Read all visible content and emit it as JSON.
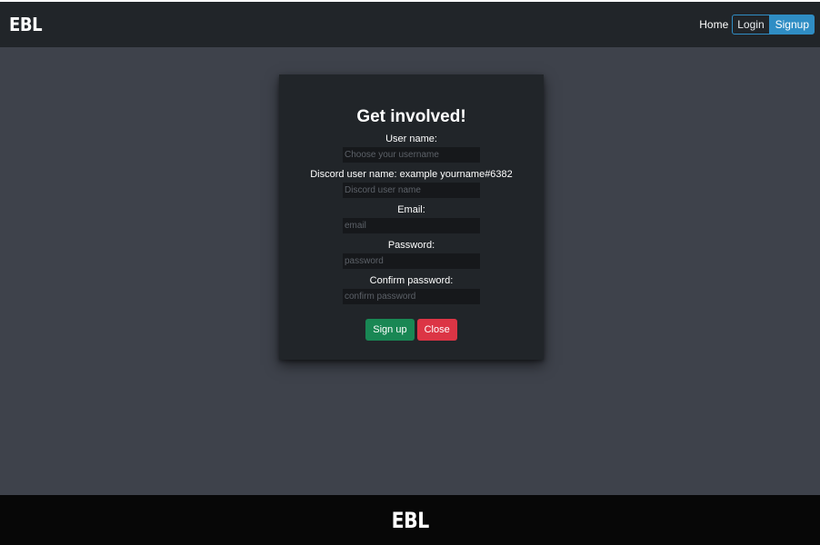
{
  "header": {
    "brand": "EBL",
    "nav": {
      "home": "Home",
      "login": "Login",
      "signup": "Signup"
    }
  },
  "modal": {
    "title": "Get involved!",
    "fields": [
      {
        "label": "User name:",
        "placeholder": "Choose your username",
        "value": ""
      },
      {
        "label": "Discord user name: example yourname#6382",
        "placeholder": "Discord user name",
        "value": ""
      },
      {
        "label": "Email:",
        "placeholder": "email",
        "value": ""
      },
      {
        "label": "Password:",
        "placeholder": "password",
        "value": ""
      },
      {
        "label": "Confirm password:",
        "placeholder": "confirm password",
        "value": ""
      }
    ],
    "buttons": {
      "submit": "Sign up",
      "close": "Close"
    }
  },
  "footer": {
    "brand": "EBL"
  },
  "colors": {
    "navbar_bg": "#212529",
    "page_bg": "#3e424b",
    "footer_bg": "#070707",
    "accent_blue": "#2f8dc4",
    "success_green": "#198754",
    "danger_red": "#dc3545"
  }
}
